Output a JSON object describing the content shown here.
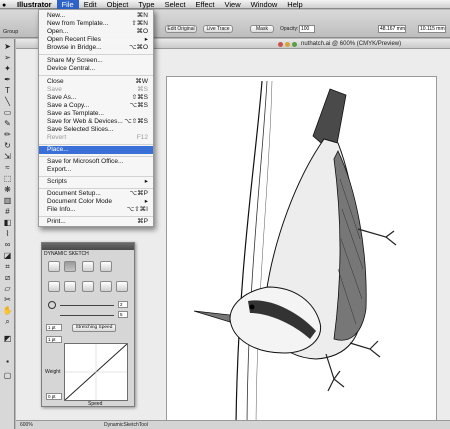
{
  "menubar": {
    "apple": "",
    "items": [
      "Illustrator",
      "File",
      "Edit",
      "Object",
      "Type",
      "Select",
      "Effect",
      "View",
      "Window",
      "Help"
    ]
  },
  "control_bar": {
    "group_label": "Group",
    "edit_original": "Edit Original",
    "live_trace": "Live Trace",
    "mask": "Mask",
    "opacity_label": "Opacity:",
    "opacity_value": "100",
    "w_value": "48.167 mm",
    "h_value": "10.115 mm"
  },
  "document": {
    "title": "nuthatch.ai @ 600% (CMYK/Preview)"
  },
  "status_bar": {
    "zoom": "600%",
    "tool": "DynamicSketchTool"
  },
  "file_menu": {
    "items": [
      {
        "label": "New...",
        "shortcut": "⌘N",
        "disabled": false
      },
      {
        "label": "New from Template...",
        "shortcut": "⇧⌘N",
        "disabled": false
      },
      {
        "label": "Open...",
        "shortcut": "⌘O",
        "disabled": false
      },
      {
        "label": "Open Recent Files",
        "shortcut": "▸",
        "disabled": false
      },
      {
        "label": "Browse in Bridge...",
        "shortcut": "⌥⌘O",
        "disabled": false
      },
      {
        "label": "Share My Screen...",
        "shortcut": "",
        "disabled": false
      },
      {
        "label": "Device Central...",
        "shortcut": "",
        "disabled": false
      },
      {
        "label": "Close",
        "shortcut": "⌘W",
        "disabled": false
      },
      {
        "label": "Save",
        "shortcut": "⌘S",
        "disabled": true
      },
      {
        "label": "Save As...",
        "shortcut": "⇧⌘S",
        "disabled": false
      },
      {
        "label": "Save a Copy...",
        "shortcut": "⌥⌘S",
        "disabled": false
      },
      {
        "label": "Save as Template...",
        "shortcut": "",
        "disabled": false
      },
      {
        "label": "Save for Web & Devices...",
        "shortcut": "⌥⇧⌘S",
        "disabled": false
      },
      {
        "label": "Save Selected Slices...",
        "shortcut": "",
        "disabled": false
      },
      {
        "label": "Revert",
        "shortcut": "F12",
        "disabled": true
      },
      {
        "label": "Place...",
        "shortcut": "",
        "disabled": false,
        "highlighted": true
      },
      {
        "label": "Save for Microsoft Office...",
        "shortcut": "",
        "disabled": false
      },
      {
        "label": "Export...",
        "shortcut": "",
        "disabled": false
      },
      {
        "label": "Scripts",
        "shortcut": "▸",
        "disabled": false
      },
      {
        "label": "Document Setup...",
        "shortcut": "⌥⌘P",
        "disabled": false
      },
      {
        "label": "Document Color Mode",
        "shortcut": "▸",
        "disabled": false
      },
      {
        "label": "File Info...",
        "shortcut": "⌥⇧⌘I",
        "disabled": false
      },
      {
        "label": "Print...",
        "shortcut": "⌘P",
        "disabled": false
      }
    ]
  },
  "panel": {
    "title": "DYNAMIC SKETCH",
    "slider1_value": "2",
    "slider2_value": "5",
    "field_a": "1 pt",
    "field_b": "1 pt",
    "dropdown": "Stretching Speed",
    "weight_label": "Weight",
    "speed_label": "Speed",
    "field_c": "0 pt"
  }
}
